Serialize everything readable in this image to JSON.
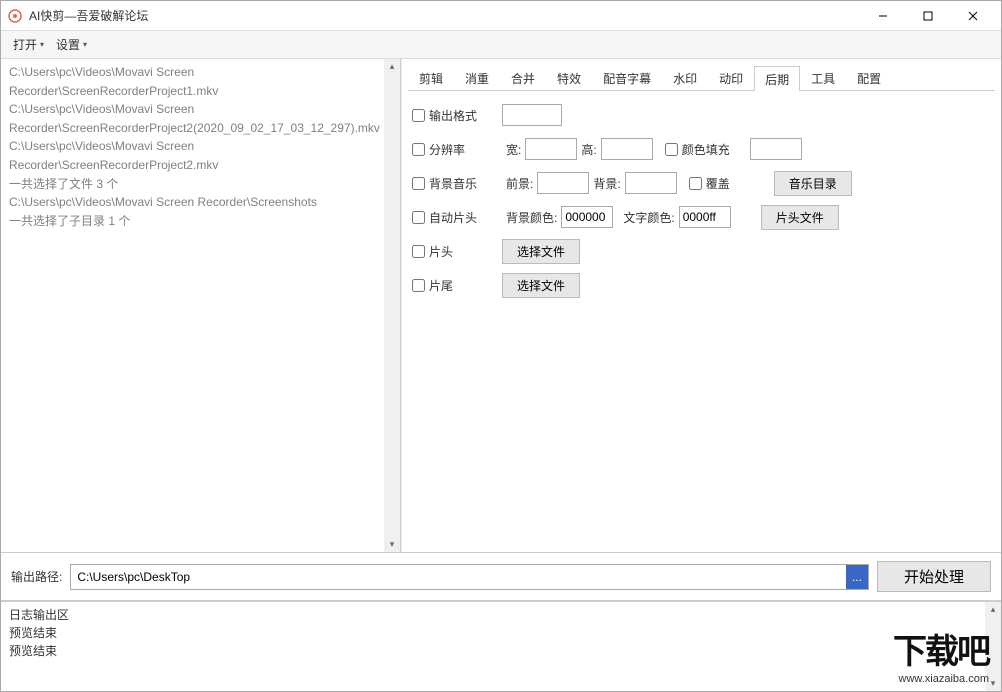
{
  "window": {
    "title": "AI快剪—吾爱破解论坛"
  },
  "menu": {
    "open": "打开",
    "settings": "设置"
  },
  "filelist": {
    "lines": [
      "C:\\Users\\pc\\Videos\\Movavi Screen Recorder\\ScreenRecorderProject1.mkv",
      "C:\\Users\\pc\\Videos\\Movavi Screen Recorder\\ScreenRecorderProject2(2020_09_02_17_03_12_297).mkv",
      "C:\\Users\\pc\\Videos\\Movavi Screen Recorder\\ScreenRecorderProject2.mkv",
      "一共选择了文件 3 个",
      "C:\\Users\\pc\\Videos\\Movavi Screen Recorder\\Screenshots",
      "一共选择了子目录 1 个"
    ]
  },
  "tabs": {
    "items": [
      "剪辑",
      "消重",
      "合并",
      "特效",
      "配音字幕",
      "水印",
      "动印",
      "后期",
      "工具",
      "配置"
    ],
    "active_index": 7
  },
  "form": {
    "output_format": {
      "label": "输出格式",
      "value": ""
    },
    "resolution": {
      "label": "分辨率",
      "width_label": "宽:",
      "width": "",
      "height_label": "高:",
      "height": "",
      "fill_label": "颜色填充",
      "fill_value": ""
    },
    "bg_music": {
      "label": "背景音乐",
      "fg_label": "前景:",
      "fg": "",
      "bg_label": "背景:",
      "bg": "",
      "overwrite_label": "覆盖",
      "dir_btn": "音乐目录"
    },
    "auto_intro": {
      "label": "自动片头",
      "bgcolor_label": "背景颜色:",
      "bgcolor": "000000",
      "textcolor_label": "文字颜色:",
      "textcolor": "0000ff",
      "file_btn": "片头文件"
    },
    "intro": {
      "label": "片头",
      "choose_btn": "选择文件"
    },
    "outro": {
      "label": "片尾",
      "choose_btn": "选择文件"
    }
  },
  "output": {
    "label": "输出路径:",
    "path": "C:\\Users\\pc\\DeskTop",
    "browse": "...",
    "start": "开始处理"
  },
  "log": {
    "lines": [
      "日志输出区",
      "预览结束",
      "预览结束"
    ]
  },
  "watermark": {
    "big": "下载吧",
    "url": "www.xiazaiba.com"
  }
}
